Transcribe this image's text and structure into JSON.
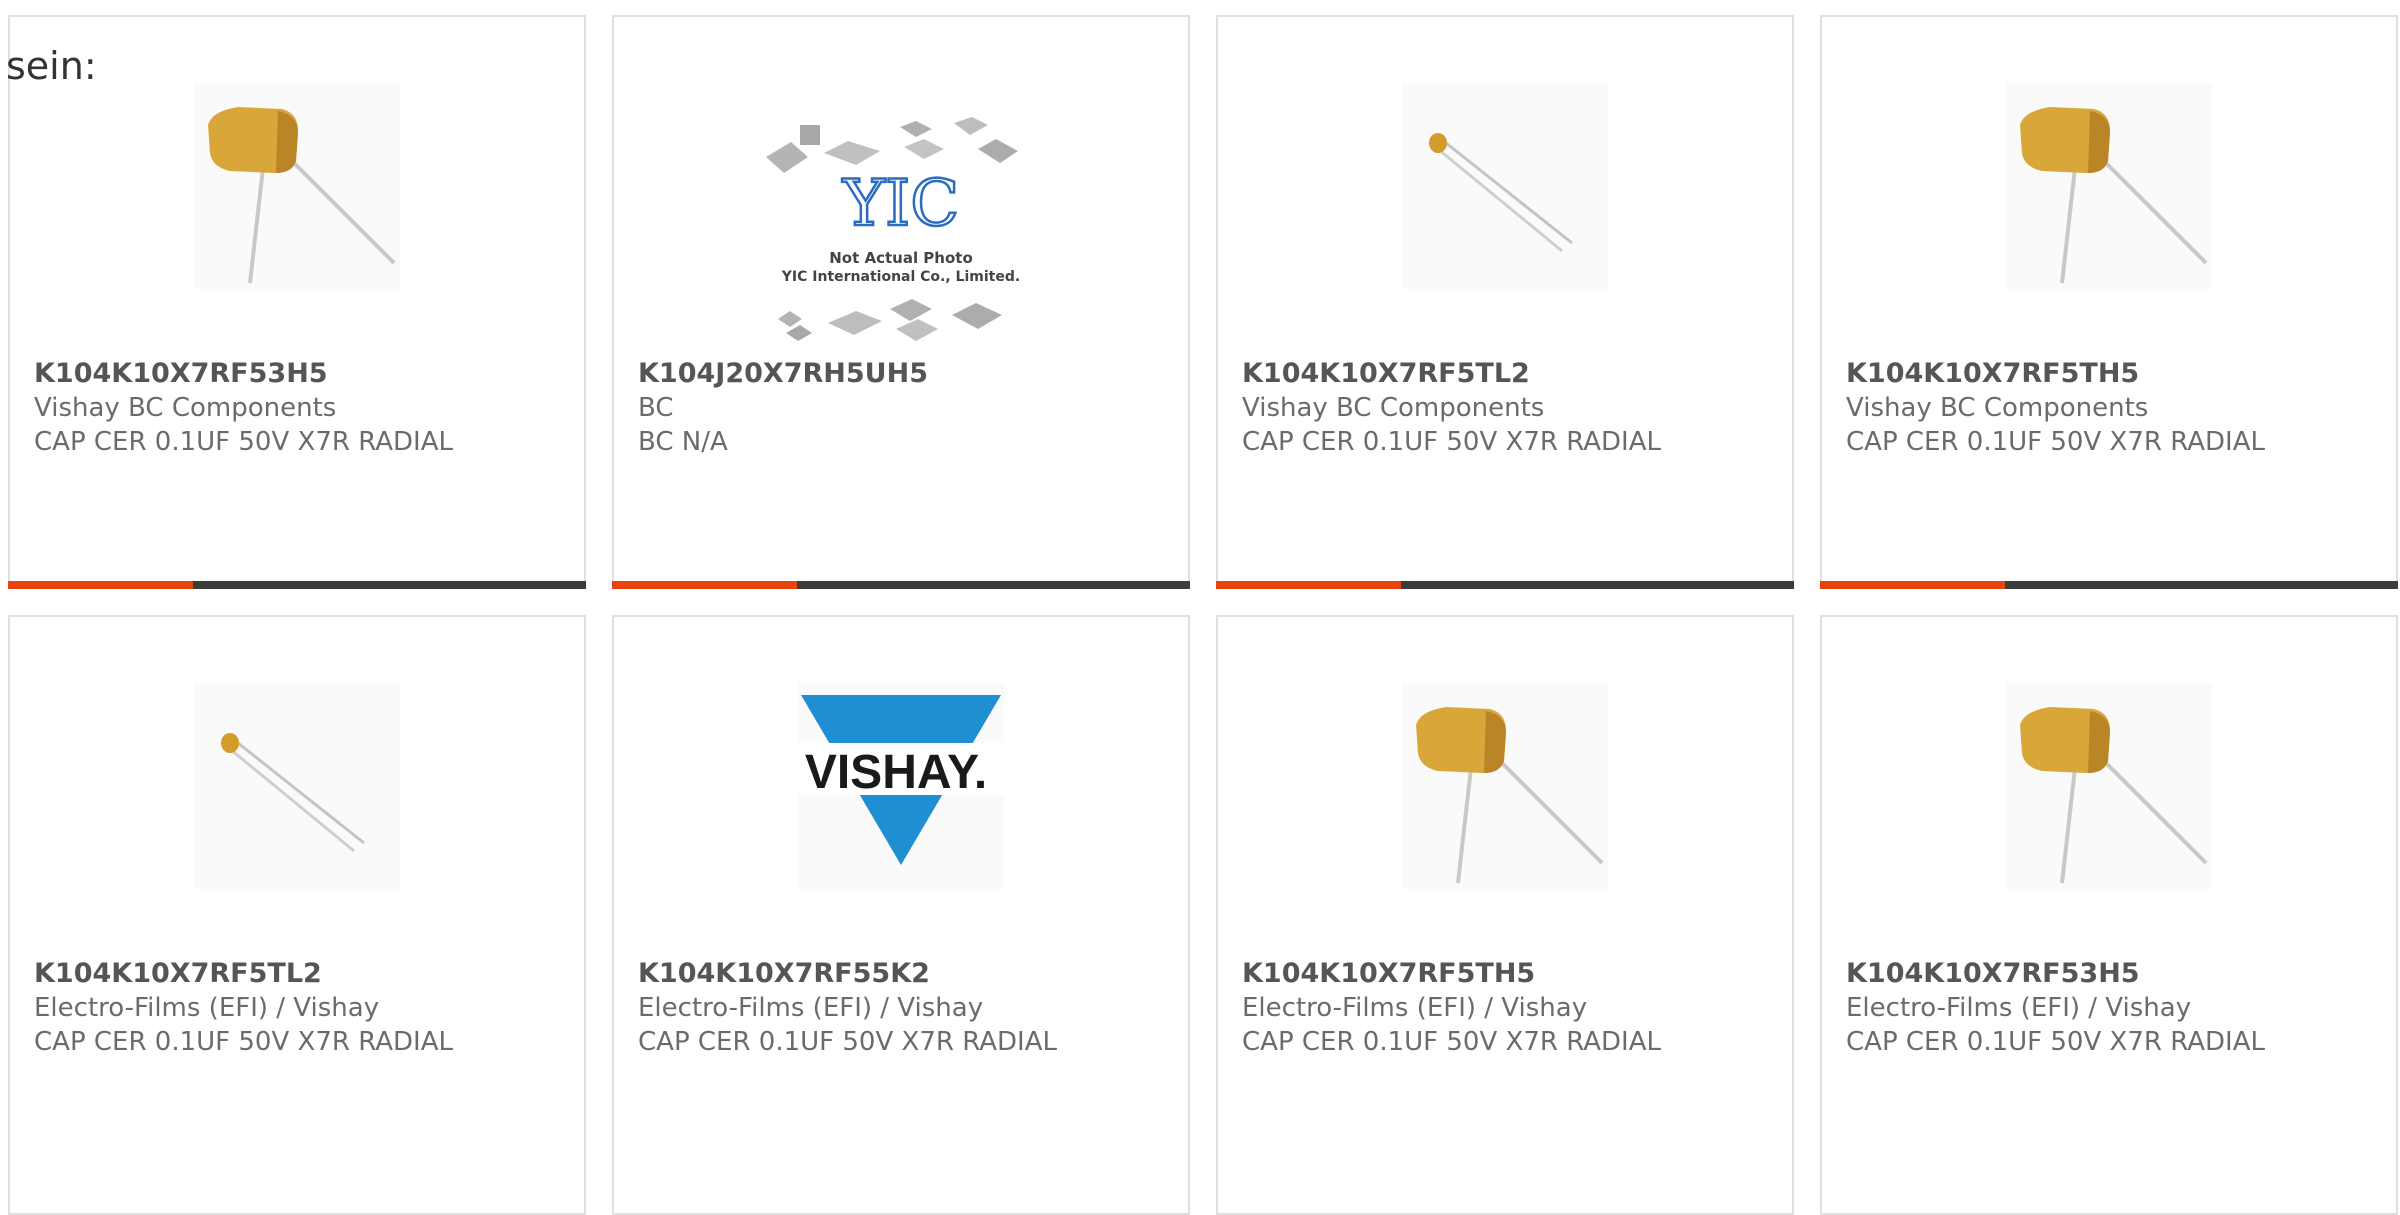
{
  "intro_text": "sein:",
  "colors": {
    "accent": "#e8420e",
    "bar_track": "#3c3c3c",
    "card_border": "#e0e0e0",
    "text": "#6b6b6b"
  },
  "cards": [
    {
      "part": "K104K10X7RF53H5",
      "manufacturer": "Vishay BC Components",
      "description": "CAP CER 0.1UF 50V X7R RADIAL",
      "image": "radial-capacitor-large",
      "progress": 0.32
    },
    {
      "part": "K104J20X7RH5UH5",
      "manufacturer": "BC",
      "description": "BC N/A",
      "image": "yic-not-actual-photo",
      "image_text": [
        "Not Actual Photo",
        "YIC International Co., Limited."
      ],
      "progress": 0.32
    },
    {
      "part": "K104K10X7RF5TL2",
      "manufacturer": "Vishay BC Components",
      "description": "CAP CER 0.1UF 50V X7R RADIAL",
      "image": "radial-capacitor-small",
      "progress": 0.32
    },
    {
      "part": "K104K10X7RF5TH5",
      "manufacturer": "Vishay BC Components",
      "description": "CAP CER 0.1UF 50V X7R RADIAL",
      "image": "radial-capacitor-large",
      "progress": 0.32
    },
    {
      "part": "K104K10X7RF5TL2",
      "manufacturer": "Electro-Films (EFI) / Vishay",
      "description": "CAP CER 0.1UF 50V X7R RADIAL",
      "image": "radial-capacitor-small"
    },
    {
      "part": "K104K10X7RF55K2",
      "manufacturer": "Electro-Films (EFI) / Vishay",
      "description": "CAP CER 0.1UF 50V X7R RADIAL",
      "image": "vishay-logo",
      "image_text": [
        "VISHAY."
      ]
    },
    {
      "part": "K104K10X7RF5TH5",
      "manufacturer": "Electro-Films (EFI) / Vishay",
      "description": "CAP CER 0.1UF 50V X7R RADIAL",
      "image": "radial-capacitor-large"
    },
    {
      "part": "K104K10X7RF53H5",
      "manufacturer": "Electro-Films (EFI) / Vishay",
      "description": "CAP CER 0.1UF 50V X7R RADIAL",
      "image": "radial-capacitor-large"
    }
  ]
}
